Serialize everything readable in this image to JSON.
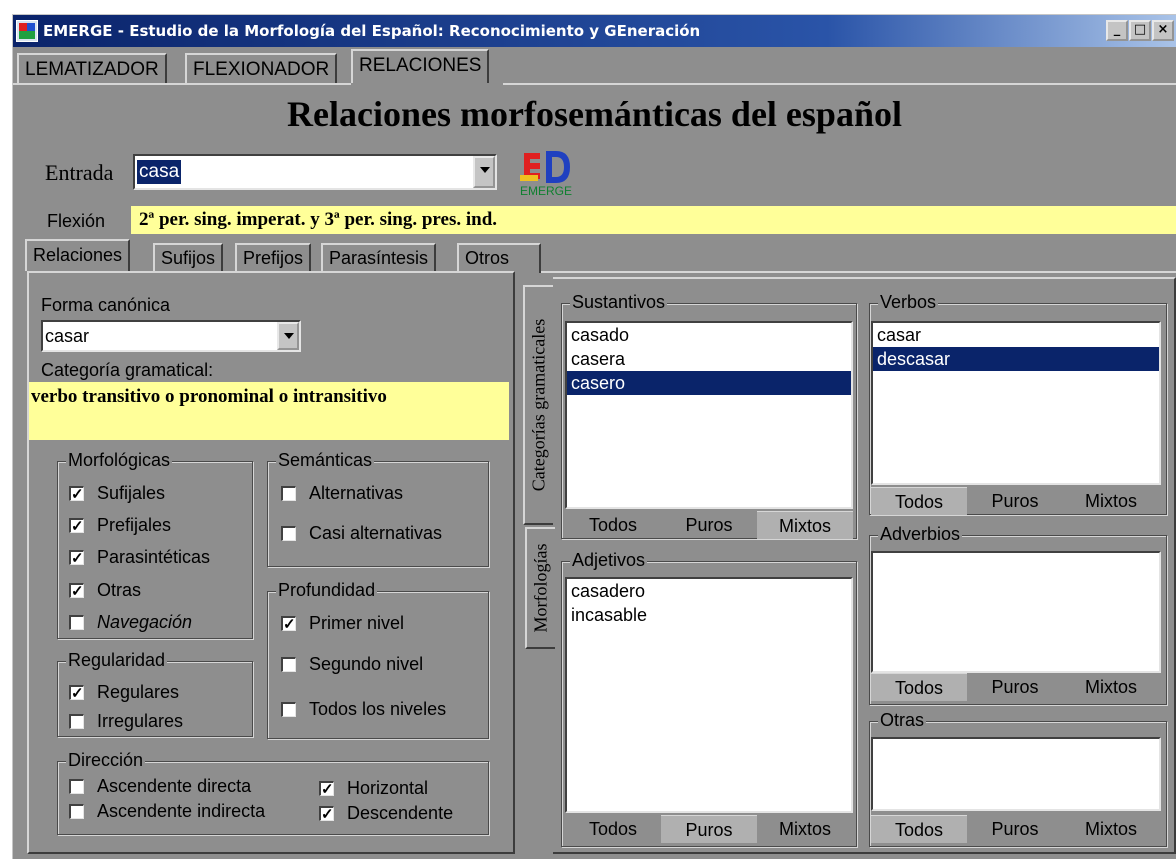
{
  "window": {
    "title": "EMERGE - Estudio de la Morfología del Español: Reconocimiento y GEneración",
    "minimize": "_",
    "maximize": "□",
    "close": "×"
  },
  "top_tabs": [
    "LEMATIZADOR",
    "FLEXIONADOR",
    "RELACIONES"
  ],
  "heading": "Relaciones morfosemánticas del español",
  "entrada": {
    "label": "Entrada",
    "value": "casa"
  },
  "logo_text": "EMERGE",
  "flexion": {
    "label": "Flexión",
    "value": "2ª per. sing. imperat. y 3ª per. sing. pres. ind."
  },
  "sub_tabs": [
    "Relaciones",
    "Sufijos",
    "Prefijos",
    "Parasíntesis",
    "Otros"
  ],
  "forma_canonica": {
    "label": "Forma canónica",
    "value": "casar"
  },
  "categoria": {
    "label": "Categoría gramatical:",
    "value": "verbo transitivo o pronominal o intransitivo"
  },
  "morfologicas": {
    "title": "Morfológicas",
    "items": [
      {
        "label": "Sufijales",
        "checked": true
      },
      {
        "label": "Prefijales",
        "checked": true
      },
      {
        "label": "Parasintéticas",
        "checked": true
      },
      {
        "label": "Otras",
        "checked": true
      },
      {
        "label": "Navegación",
        "checked": false
      }
    ]
  },
  "semanticas": {
    "title": "Semánticas",
    "items": [
      {
        "label": "Alternativas",
        "checked": false
      },
      {
        "label": "Casi alternativas",
        "checked": false
      }
    ]
  },
  "regularidad": {
    "title": "Regularidad",
    "items": [
      {
        "label": "Regulares",
        "checked": true
      },
      {
        "label": "Irregulares",
        "checked": false
      }
    ]
  },
  "profundidad": {
    "title": "Profundidad",
    "items": [
      {
        "label": "Primer nivel",
        "checked": true
      },
      {
        "label": "Segundo nivel",
        "checked": false
      },
      {
        "label": "Todos los niveles",
        "checked": false
      }
    ]
  },
  "direccion": {
    "title": "Dirección",
    "items": [
      {
        "label": "Ascendente directa",
        "checked": false
      },
      {
        "label": "Ascendente indirecta",
        "checked": false
      },
      {
        "label": "Horizontal",
        "checked": true
      },
      {
        "label": "Descendente",
        "checked": true
      }
    ]
  },
  "side_tabs": [
    "Categorías gramaticales",
    "Morfologías"
  ],
  "filter_buttons": [
    "Todos",
    "Puros",
    "Mixtos"
  ],
  "sustantivos": {
    "title": "Sustantivos",
    "items": [
      "casado",
      "casera",
      "casero"
    ],
    "selected": 2,
    "pressed": 2
  },
  "adjetivos": {
    "title": "Adjetivos",
    "items": [
      "casadero",
      "incasable"
    ],
    "selected": -1,
    "pressed": 1
  },
  "verbos": {
    "title": "Verbos",
    "items": [
      "casar",
      "descasar"
    ],
    "selected": 1,
    "pressed": 0
  },
  "adverbios": {
    "title": "Adverbios",
    "items": [],
    "selected": -1,
    "pressed": 0
  },
  "otras": {
    "title": "Otras",
    "items": [],
    "selected": -1,
    "pressed": 0
  },
  "colors": {
    "selection": "#0a246a",
    "highlight": "#ffff99",
    "face": "#8e8e8e"
  }
}
